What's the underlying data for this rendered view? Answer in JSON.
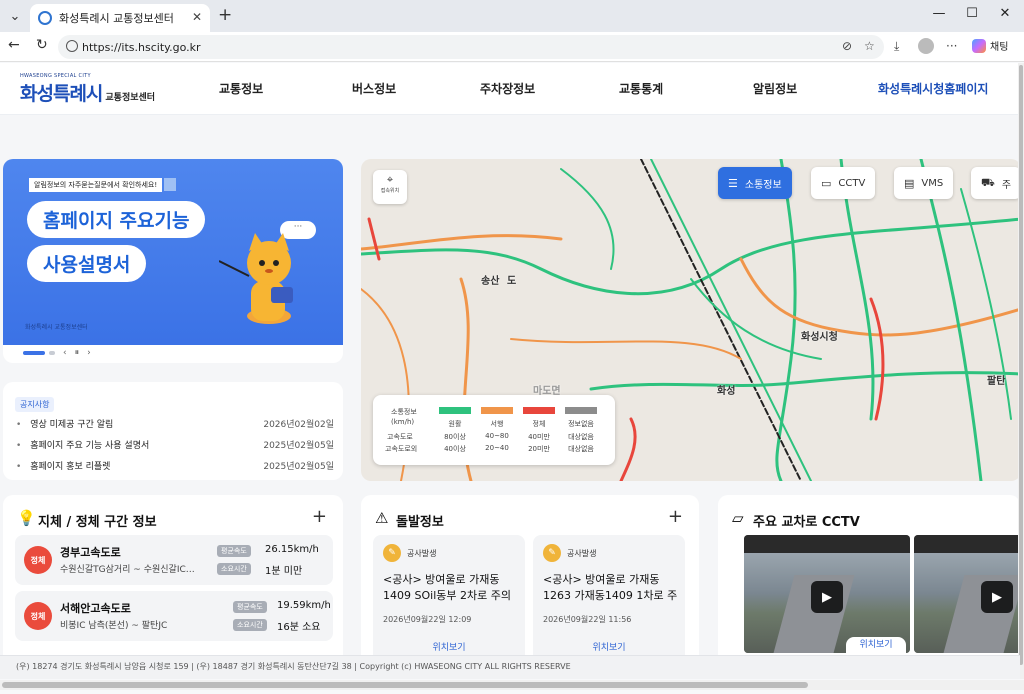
{
  "browser": {
    "tab_title": "화성특례시 교통정보센터",
    "url": "https://its.hscity.go.kr",
    "chat_label": "채팅"
  },
  "header": {
    "logo_small": "HWASEONG SPECIAL CITY",
    "logo_main": "화성특례시",
    "logo_sub": "교통정보센터",
    "nav": [
      "교통정보",
      "버스정보",
      "주차장정보",
      "교통통계",
      "알림정보",
      "화성특례시청홈페이지"
    ]
  },
  "banner": {
    "notice": "알림정보의 자주묻는질문에서 확인하세요!",
    "line1": "홈페이지 주요기능",
    "line2": "사용설명서",
    "bubble": "···",
    "mini_logo": "화성특례시 교통정보센터"
  },
  "notices": {
    "tag": "공지사항",
    "items": [
      {
        "title": "영상 미제공 구간 알림",
        "date": "2026년02월02일"
      },
      {
        "title": "홈페이지 주요 기능 사용 설명서",
        "date": "2025년02월05일"
      },
      {
        "title": "홈페이지 홍보 리플렛",
        "date": "2025년02월05일"
      }
    ]
  },
  "map": {
    "location_label": "접속위치",
    "buttons": [
      "소통정보",
      "CCTV",
      "VMS",
      "주"
    ],
    "labels": [
      "송산",
      "도",
      "화성시청",
      "마도면",
      "화성",
      "팔탄"
    ],
    "legend": {
      "title": "소통정보",
      "unit": "(km/h)",
      "row1_label": "고속도로",
      "row2_label": "고속도로외",
      "cols": [
        {
          "name": "원활",
          "r1": "80이상",
          "r2": "40이상",
          "color": "#2ec27e"
        },
        {
          "name": "서행",
          "r1": "40~80",
          "r2": "20~40",
          "color": "#f0954a"
        },
        {
          "name": "정체",
          "r1": "40미만",
          "r2": "20미만",
          "color": "#e8463c"
        },
        {
          "name": "정보없음",
          "r1": "대상없음",
          "r2": "대상없음",
          "color": "#8c8c8c"
        }
      ]
    }
  },
  "congestion": {
    "title": "지체 / 정체 구간 정보",
    "items": [
      {
        "badge": "정체",
        "name": "경부고속도로",
        "section": "수원신갈TG삼거리 ~ 수원신갈IC진…",
        "speed_label": "평균속도",
        "speed": "26.15km/h",
        "time_label": "소요시간",
        "time": "1분 미만"
      },
      {
        "badge": "정체",
        "name": "서해안고속도로",
        "section": "비봉IC 남측(본선) ~ 팔탄JC",
        "speed_label": "평균속도",
        "speed": "19.59km/h",
        "time_label": "소요시간",
        "time": "16분 소요"
      }
    ]
  },
  "incidents": {
    "title": "돌발정보",
    "items": [
      {
        "type": "공사발생",
        "body": "<공사> 방여울로 가재동 1409 SOil동부 2차로 주의",
        "date": "2026년09월22일 12:09",
        "link": "위치보기"
      },
      {
        "type": "공사발생",
        "body": "<공사> 방여울로 가재동 1263 가재동1409 1차로 주",
        "date": "2026년09월22일 11:56",
        "link": "위치보기"
      }
    ]
  },
  "cctv": {
    "title": "주요 교차로 CCTV",
    "link": "위치보기"
  },
  "footer": {
    "text": "(우) 18274 경기도 화성특례시 남양읍 시청로 159 | (우) 18487 경기 화성특례시 동탄산단7길 38 | Copyright (c) HWASEONG CITY ALL RIGHTS RESERVE"
  }
}
